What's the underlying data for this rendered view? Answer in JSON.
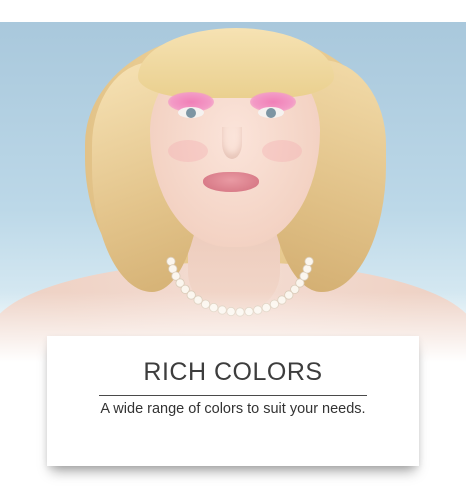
{
  "feature_card": {
    "title": "RICH COLORS",
    "subtitle": "A wide range of colors to suit your needs."
  },
  "photo": {
    "subject": "model-portrait",
    "accent_colors": {
      "background": "#bcd8e8",
      "hair": "#e7c98f",
      "eyeshadow": "#f07fb7",
      "lips": "#d97c89"
    }
  }
}
